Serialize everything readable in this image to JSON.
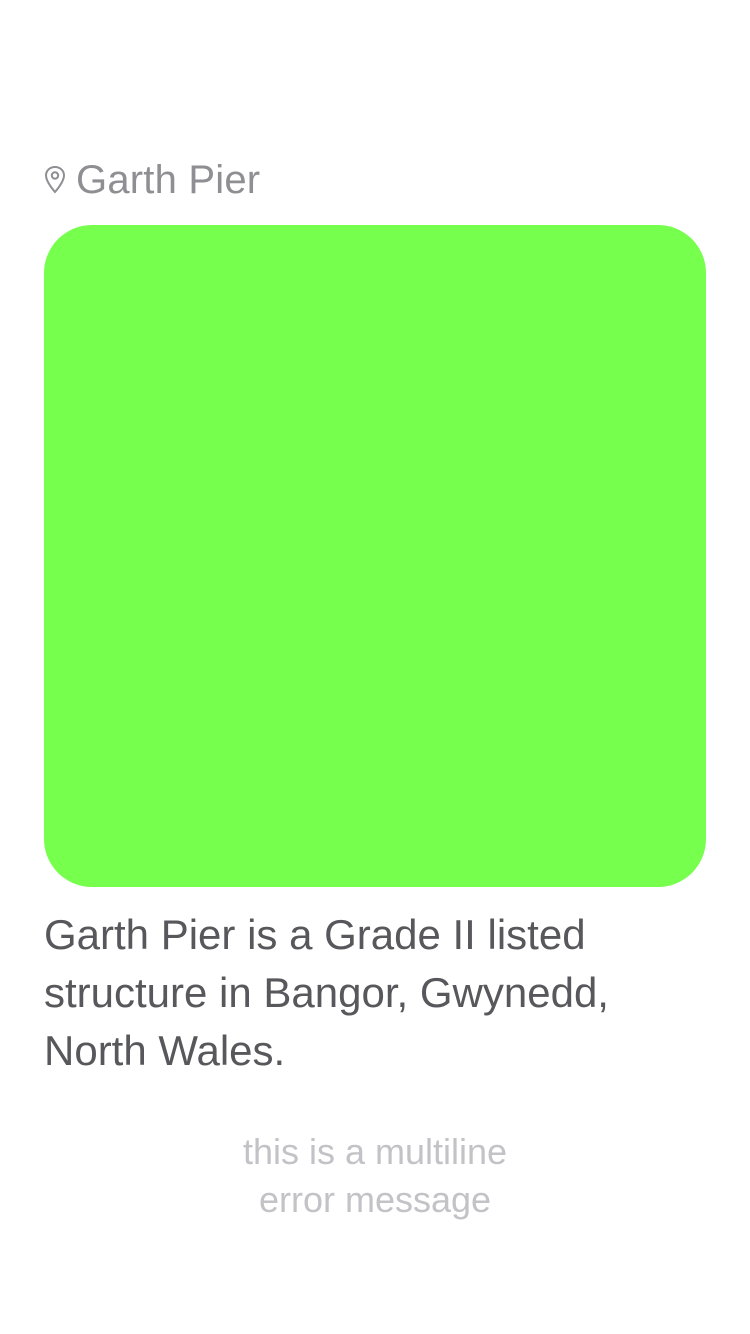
{
  "location": {
    "icon": "map-pin-icon",
    "title": "Garth Pier"
  },
  "image_card": {
    "color": "#77ff4d"
  },
  "description": "Garth Pier is a Grade II listed structure in Bangor, Gwynedd, North Wales.",
  "error_message": "this is a multiline\nerror message"
}
